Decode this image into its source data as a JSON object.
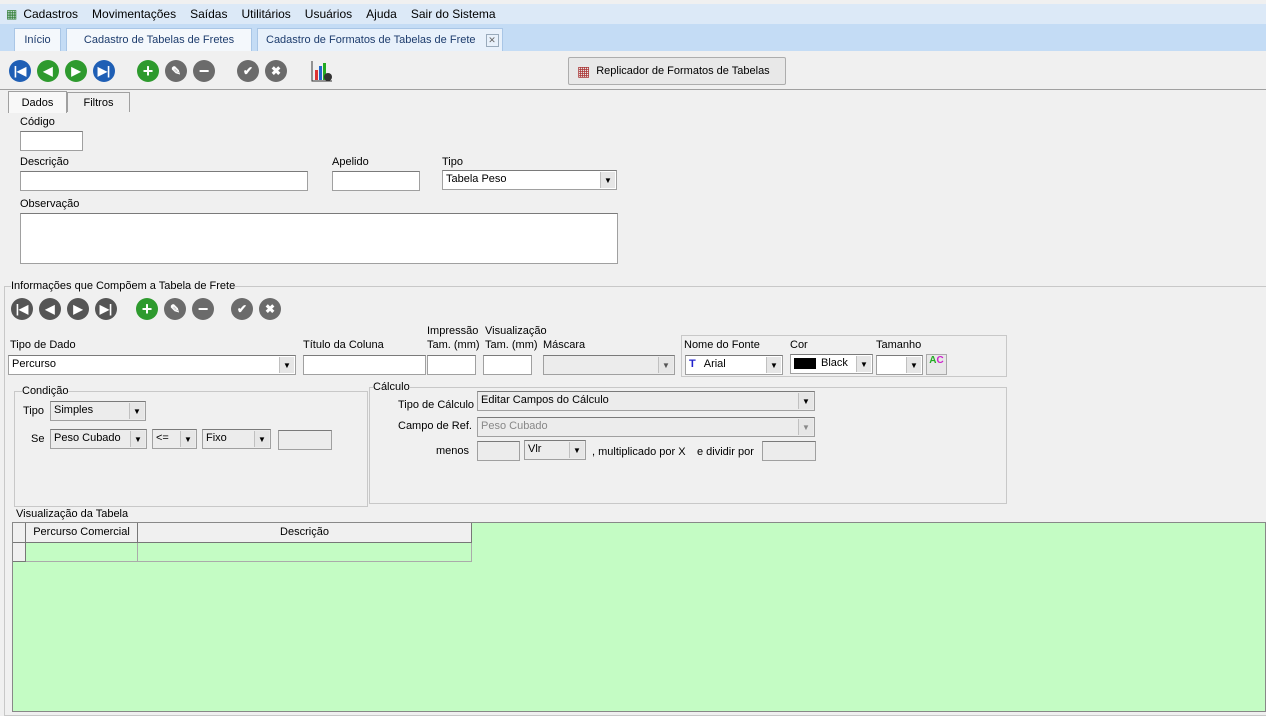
{
  "menu": [
    "Cadastros",
    "Movimentações",
    "Saídas",
    "Utilitários",
    "Usuários",
    "Ajuda",
    "Sair do Sistema"
  ],
  "tabs": [
    "Início",
    "Cadastro de Tabelas de Fretes",
    "Cadastro de Formatos de Tabelas de Frete"
  ],
  "toolbar": {
    "replicator": "Replicador de Formatos de Tabelas"
  },
  "subtabs": [
    "Dados",
    "Filtros"
  ],
  "form": {
    "codigo_label": "Código",
    "descricao_label": "Descrição",
    "apelido_label": "Apelido",
    "tipo_label": "Tipo",
    "tipo_value": "Tabela Peso",
    "observacao_label": "Observação"
  },
  "info": {
    "title": "Informações que Compõem a Tabela de Frete",
    "tipo_dado_label": "Tipo de Dado",
    "tipo_dado_value": "Percurso",
    "titulo_coluna_label": "Título da Coluna",
    "impressao_label": "Impressão",
    "impressao_tam": "Tam. (mm)",
    "visualizacao_label": "Visualização",
    "visualizacao_tam": "Tam. (mm)",
    "mascara_label": "Máscara",
    "fonte_label": "Nome do Fonte",
    "fonte_value": "Arial",
    "cor_label": "Cor",
    "cor_value": "Black",
    "tamanho_label": "Tamanho"
  },
  "condicao": {
    "title": "Condição",
    "tipo_label": "Tipo",
    "tipo_value": "Simples",
    "se_label": "Se",
    "campo_value": "Peso Cubado",
    "op_value": "<=",
    "fixo_value": "Fixo"
  },
  "calculo": {
    "title": "Cálculo",
    "tipo_label": "Tipo de Cálculo",
    "tipo_value": "Editar Campos do Cálculo",
    "campo_label": "Campo de Ref.",
    "campo_value": "Peso Cubado",
    "menos_label": "menos",
    "vlr_value": "Vlr",
    "mult_label": ", multiplicado por X",
    "div_label": "e dividir por"
  },
  "grid": {
    "title": "Visualização da Tabela",
    "columns": [
      "Percurso Comercial",
      "Descrição"
    ],
    "bg": "#c4fcc4"
  }
}
